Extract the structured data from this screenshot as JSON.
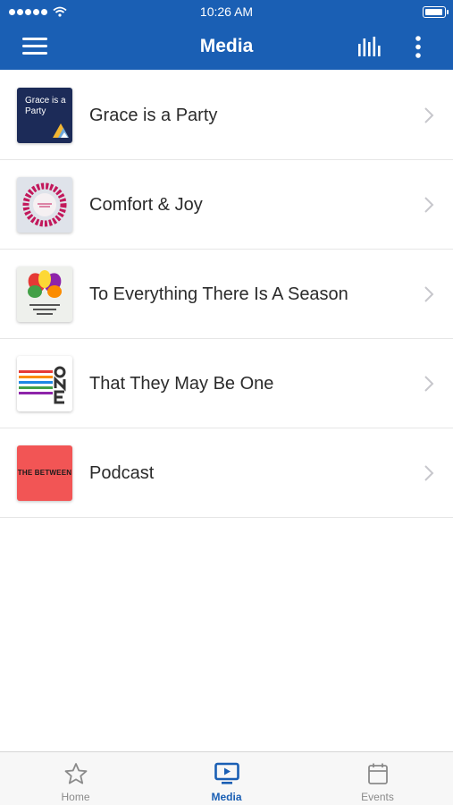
{
  "status_bar": {
    "time": "10:26 AM"
  },
  "header": {
    "title": "Media"
  },
  "media_items": [
    {
      "title": "Grace is a Party",
      "thumb_text": "Grace is a Party"
    },
    {
      "title": "Comfort & Joy"
    },
    {
      "title": "To Everything There Is A Season"
    },
    {
      "title": "That They May Be One"
    },
    {
      "title": "Podcast",
      "thumb_text": "THE BETWEEN"
    }
  ],
  "tabs": [
    {
      "label": "Home",
      "icon": "star-icon",
      "active": false
    },
    {
      "label": "Media",
      "icon": "tv-play-icon",
      "active": true
    },
    {
      "label": "Events",
      "icon": "calendar-icon",
      "active": false
    }
  ],
  "colors": {
    "brand": "#1a5fb4",
    "tab_inactive": "#8a8a8a",
    "divider": "#e6e6e6"
  }
}
